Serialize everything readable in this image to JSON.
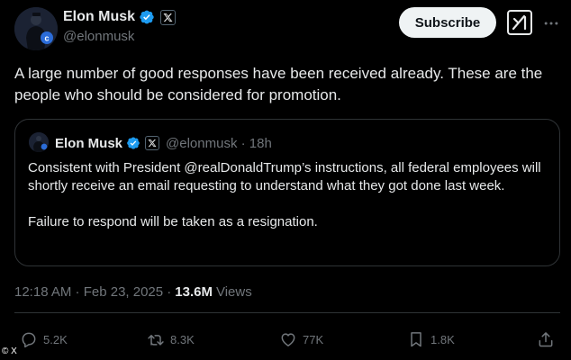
{
  "author": {
    "name": "Elon Musk",
    "handle": "@elonmusk"
  },
  "header": {
    "subscribe_label": "Subscribe"
  },
  "post": {
    "text": "A large number of good responses have been received already. These are the people who should be considered for promotion."
  },
  "quote": {
    "name": "Elon Musk",
    "meta": "@elonmusk · 18h",
    "paragraphs": [
      "Consistent with President @realDonaldTrump’s instructions, all federal employees will shortly receive an email requesting to understand what they got done last week.",
      "Failure to respond will be taken as a resignation."
    ]
  },
  "meta": {
    "timestamp": "12:18 AM · Feb 23, 2025 ·",
    "views_count": "13.6M",
    "views_label": "Views"
  },
  "actions": {
    "replies": "5.2K",
    "reposts": "8.3K",
    "likes": "77K",
    "bookmarks": "1.8K"
  },
  "credit": "© X",
  "colors": {
    "background": "#000000",
    "verified": "#1d9bf0",
    "secondary_text": "#71767b",
    "border": "#2f3336"
  },
  "icons": [
    "verified-badge-icon",
    "x-affiliation-icon",
    "grok-icon",
    "more-icon",
    "reply-icon",
    "repost-icon",
    "like-icon",
    "bookmark-icon",
    "share-icon"
  ]
}
